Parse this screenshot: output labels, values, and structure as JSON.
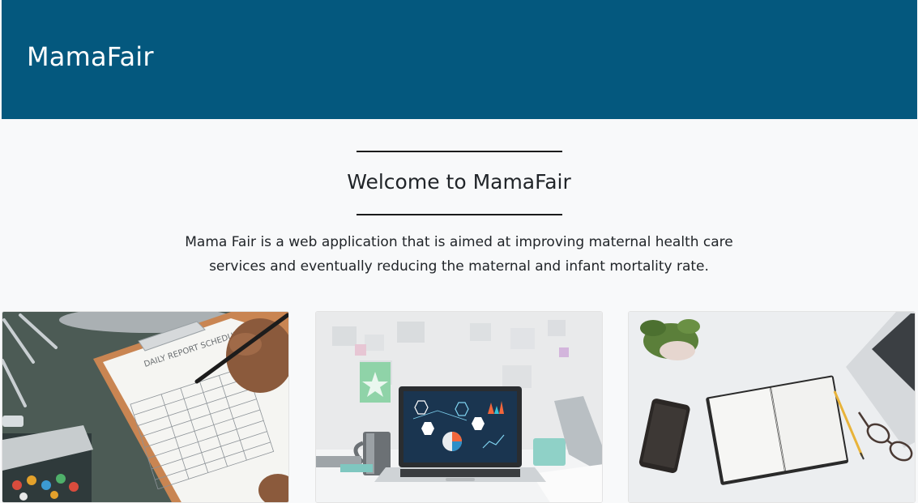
{
  "header": {
    "brand": "MamaFair"
  },
  "intro": {
    "heading": "Welcome to MamaFair",
    "description": "Mama Fair is a web application that is aimed at improving maternal health care services and eventually reducing the maternal and infant mortality rate."
  },
  "cards": [
    {
      "image": "clipboard-daily-report-photo",
      "image_text": "DAILY REPORT SCHEDULE"
    },
    {
      "image": "laptop-dashboard-desk-photo"
    },
    {
      "image": "notebook-phone-desk-photo"
    }
  ],
  "colors": {
    "header_bg": "#04587e",
    "page_bg": "#f8f9fa",
    "text": "#212529"
  }
}
